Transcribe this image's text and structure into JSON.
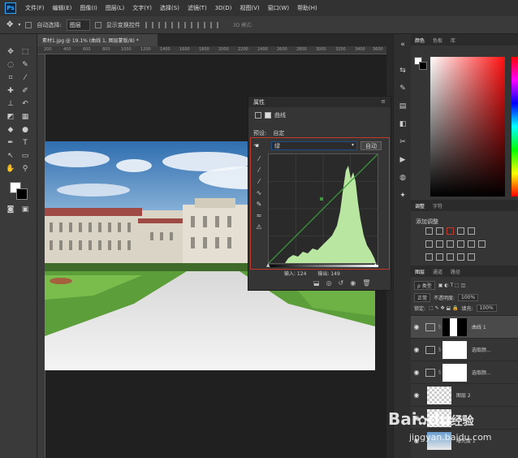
{
  "menubar": {
    "logo": "Ps",
    "items": [
      "文件(F)",
      "编辑(E)",
      "图像(I)",
      "图层(L)",
      "文字(Y)",
      "选择(S)",
      "滤镜(T)",
      "3D(D)",
      "视图(V)",
      "窗口(W)",
      "帮助(H)"
    ]
  },
  "options": {
    "auto_select": "自动选择:",
    "target": "图层",
    "show_transform": "显示变换控件",
    "mode3d": "3D 模式:"
  },
  "doc_tab": "素材1.jpg @ 19.1% (曲线 1, 图层蒙版/8) *",
  "ruler_labels": [
    "200",
    "400",
    "600",
    "800",
    "1000",
    "1200",
    "1400",
    "1600",
    "1800",
    "2000",
    "2200",
    "2400",
    "2600",
    "2800",
    "3000",
    "3200",
    "3400",
    "3600"
  ],
  "properties": {
    "header": "属性",
    "title": "曲线",
    "preset_label": "预设:",
    "preset_value": "自定",
    "channel": "绿",
    "auto": "自动",
    "input_label": "输入: 124",
    "output_label": "输出: 149"
  },
  "right": {
    "color_tabs": [
      "颜色",
      "色板",
      "库"
    ],
    "adj_tabs": [
      "调整",
      "字符"
    ],
    "adj_title": "添加调整",
    "layers_tabs": [
      "图层",
      "通道",
      "路径"
    ],
    "kind": "ρ 类型",
    "blend": "正常",
    "opacity_label": "不透明度:",
    "opacity": "100%",
    "lock_label": "锁定:",
    "fill_label": "填充:",
    "fill": "100%",
    "layers": [
      {
        "name": "曲线 1"
      },
      {
        "name": "选取颜..."
      },
      {
        "name": "选取颜..."
      },
      {
        "name": "图层 2"
      },
      {
        "name": "图层 1"
      },
      {
        "name": "曝光度 1"
      }
    ]
  },
  "watermark": {
    "brand": "Bai",
    "brand_mid": "du",
    "brand_cn": "经验",
    "url": "jingyan.baidu.com"
  }
}
